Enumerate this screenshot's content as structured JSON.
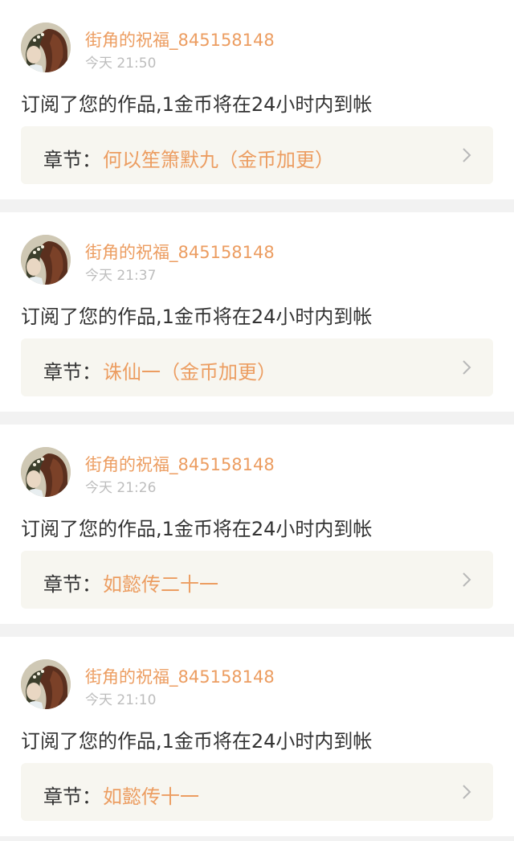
{
  "colors": {
    "accent": "#ec9d61",
    "text": "#333333",
    "muted": "#bdbdbd",
    "box": "#f7f6f0",
    "divider": "#f2f2f2"
  },
  "notifications": [
    {
      "username": "街角的祝福_845158148",
      "time": "今天 21:50",
      "message": "订阅了您的作品,1金币将在24小时内到帐",
      "chapter_label": "章节：",
      "chapter_title": "何以笙箫默九（金币加更）",
      "avatar_icon": "user-avatar-icon",
      "chevron_icon": "chevron-right-icon"
    },
    {
      "username": "街角的祝福_845158148",
      "time": "今天 21:37",
      "message": "订阅了您的作品,1金币将在24小时内到帐",
      "chapter_label": "章节：",
      "chapter_title": "诛仙一（金币加更）",
      "avatar_icon": "user-avatar-icon",
      "chevron_icon": "chevron-right-icon"
    },
    {
      "username": "街角的祝福_845158148",
      "time": "今天 21:26",
      "message": "订阅了您的作品,1金币将在24小时内到帐",
      "chapter_label": "章节：",
      "chapter_title": "如懿传二十一",
      "avatar_icon": "user-avatar-icon",
      "chevron_icon": "chevron-right-icon"
    },
    {
      "username": "街角的祝福_845158148",
      "time": "今天 21:10",
      "message": "订阅了您的作品,1金币将在24小时内到帐",
      "chapter_label": "章节：",
      "chapter_title": "如懿传十一",
      "avatar_icon": "user-avatar-icon",
      "chevron_icon": "chevron-right-icon"
    }
  ]
}
